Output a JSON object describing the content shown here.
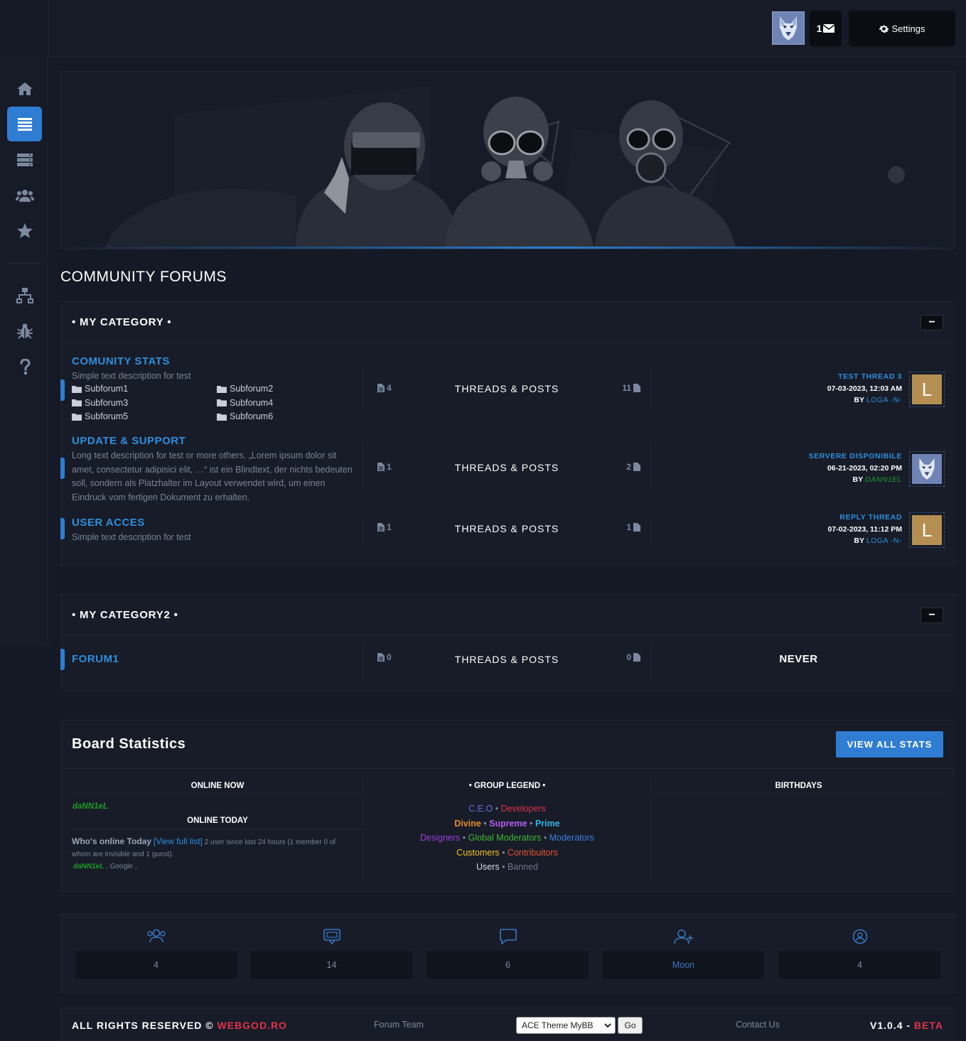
{
  "topbar": {
    "message_count": "1",
    "settings_label": "Settings"
  },
  "sidebar": {
    "items": [
      {
        "icon": "home-icon"
      },
      {
        "icon": "list-icon",
        "active": true
      },
      {
        "icon": "server-icon"
      },
      {
        "icon": "users-icon"
      },
      {
        "icon": "star-icon"
      },
      {
        "icon": "sitemap-icon"
      },
      {
        "icon": "bug-icon"
      },
      {
        "icon": "question-icon"
      }
    ]
  },
  "page_title": "COMMUNITY FORUMS",
  "categories": [
    {
      "title": "• MY CATEGORY •",
      "collapse_label": "−",
      "forums": [
        {
          "name": "COMUNITY STATS",
          "description": "Simple text description for test",
          "subforums": [
            "Subforum1",
            "Subforum2",
            "Subforum3",
            "Subforum4",
            "Subforum5",
            "Subforum6"
          ],
          "threads": "4",
          "label": "THREADS & POSTS",
          "posts": "11",
          "last_thread": "TEST THREAD 3",
          "last_date": "07-03-2023, 12:03 AM",
          "by": "BY",
          "last_user": "LOGA -N-",
          "avatar_letter": "L"
        },
        {
          "name": "UPDATE & SUPPORT",
          "description": "Long text description for test or more others. „Lorem ipsum dolor sit amet, consectetur adipisici elit, …“ ist ein Blindtext, der nichts bedeuten soll, sondern als Platzhalter im Layout verwendet wird, um einen Eindruck vom fertigen Dokument zu erhalten.",
          "threads": "1",
          "label": "THREADS & POSTS",
          "posts": "2",
          "last_thread": "SERVERE DISPONIBILE",
          "last_date": "06-21-2023, 02:20 PM",
          "by": "BY",
          "last_user": "DANN1EL"
        },
        {
          "name": "USER ACCES",
          "description": "Simple text description for test",
          "threads": "1",
          "label": "THREADS & POSTS",
          "posts": "1",
          "last_thread": "REPLY THREAD",
          "last_date": "07-02-2023, 11:12 PM",
          "by": "BY",
          "last_user": "LOGA -N-",
          "avatar_letter": "L"
        }
      ]
    },
    {
      "title": "• MY CATEGORY2 •",
      "collapse_label": "−",
      "forums": [
        {
          "name": "FORUM1",
          "threads": "0",
          "label": "THREADS & POSTS",
          "posts": "0",
          "last": "NEVER"
        }
      ]
    }
  ],
  "stats": {
    "title": "Board Statistics",
    "view_all": "VIEW ALL STATS",
    "online_now_head": "ONLINE NOW",
    "online_now_user": "daNN1eL",
    "online_today_head": "ONLINE TODAY",
    "whos_online_label": "Who's online Today",
    "view_full_list": "[View full list]",
    "online_today_desc": "2 user since last 24 hours (1 member 0 of whom are invisible and 1 guest).",
    "online_today_users": "daNN1eL",
    "online_today_guest": ", Google ,",
    "group_legend_head": "• GROUP LEGEND •",
    "groups": [
      {
        "name": "C.E.O",
        "color": "#6f6fdc"
      },
      {
        "name": "Developers",
        "color": "#e0334a"
      },
      {
        "name": "Divine",
        "color": "#e58a2c"
      },
      {
        "name": "Supreme",
        "color": "#b65cf0"
      },
      {
        "name": "Prime",
        "color": "#2fb6e8"
      },
      {
        "name": "Designers",
        "color": "#9d3fe0"
      },
      {
        "name": "Global Moderators",
        "color": "#3fb82f"
      },
      {
        "name": "Moderators",
        "color": "#3c7fe0"
      },
      {
        "name": "Customers",
        "color": "#f2c32b"
      },
      {
        "name": "Contribuitors",
        "color": "#e0522f"
      },
      {
        "name": "Users",
        "color": "#d8dce4"
      },
      {
        "name": "Banned",
        "color": "#6e7688"
      }
    ],
    "birthdays_head": "BIRTHDAYS"
  },
  "features": [
    {
      "icon": "users-icon",
      "value": "4"
    },
    {
      "icon": "threads-icon",
      "value": "14"
    },
    {
      "icon": "posts-icon",
      "value": "6"
    },
    {
      "icon": "new-member-icon",
      "value": "Moon"
    },
    {
      "icon": "online-icon",
      "value": "4"
    }
  ],
  "footer": {
    "rights": "ALL RIGHTS RESERVED ©",
    "brand": "WEBGOD.RO",
    "forum_team": "Forum Team",
    "theme_selected": "ACE Theme MyBB",
    "go": "Go",
    "contact": "Contact Us",
    "version": "V1.0.4 -",
    "beta": "BETA"
  }
}
